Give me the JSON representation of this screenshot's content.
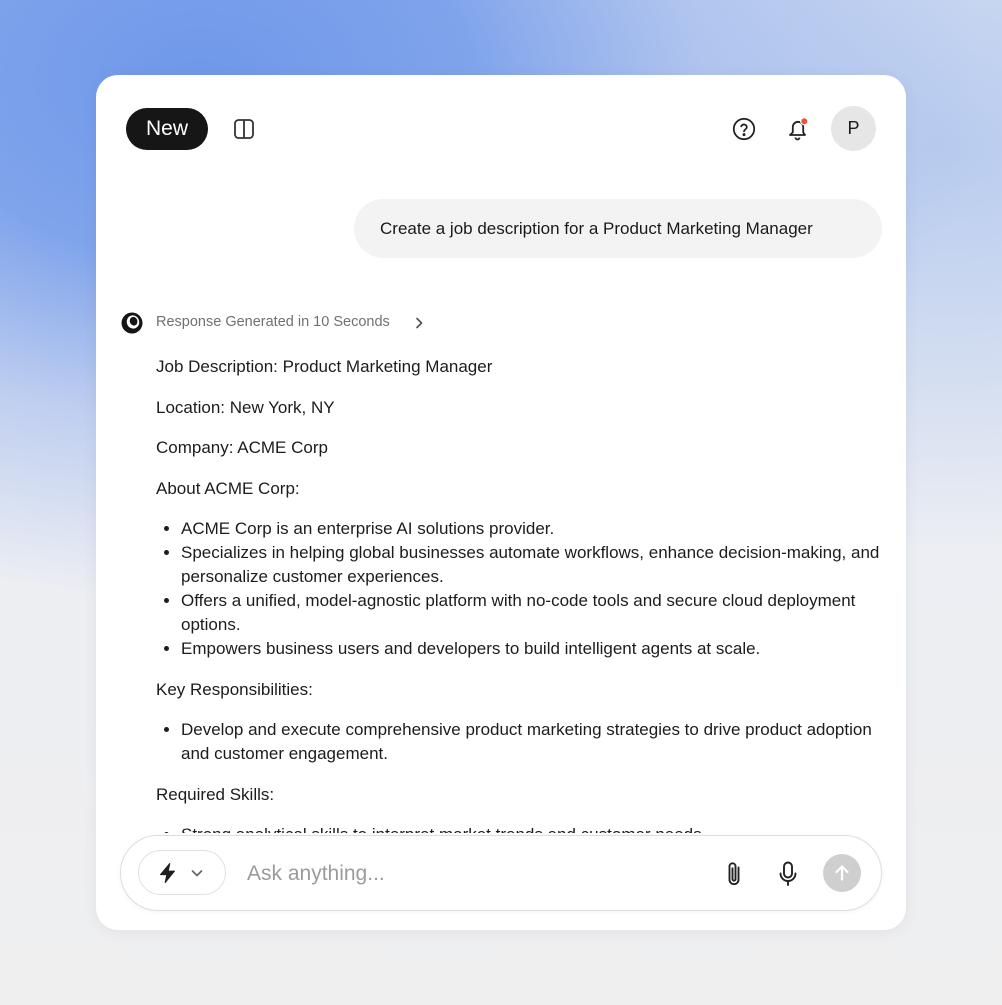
{
  "header": {
    "new_label": "New",
    "avatar_initial": "P",
    "notification_dot_color": "#f0533a"
  },
  "conversation": {
    "user_message": "Create a job description for a Product Marketing Manager",
    "response_status": "Response Generated in 10 Seconds",
    "response": {
      "title": "Job Description: Product Marketing Manager",
      "location": "Location: New York, NY",
      "company": "Company: ACME Corp",
      "about_heading": "About ACME Corp:",
      "about_items": [
        "ACME Corp is an enterprise AI solutions provider.",
        "Specializes in helping global businesses automate workflows, enhance decision-making, and personalize customer experiences.",
        "Offers a unified, model-agnostic platform with no-code tools and secure cloud deployment options.",
        "Empowers business users and developers to build intelligent agents at scale."
      ],
      "responsibilities_heading": "Key Responsibilities:",
      "responsibilities_items": [
        "Develop and execute comprehensive product marketing strategies to drive product adoption and customer engagement."
      ],
      "skills_heading": "Required Skills:",
      "skills_items": [
        "Strong analytical skills to interpret market trends and customer needs."
      ]
    }
  },
  "composer": {
    "placeholder": "Ask anything..."
  },
  "icons": {
    "sidebar_toggle": "sidebar-toggle-icon",
    "help": "help-icon",
    "bell": "bell-icon",
    "logo": "brand-logo-icon",
    "chevron_right": "chevron-right-icon",
    "bolt": "bolt-icon",
    "chevron_down": "chevron-down-icon",
    "attach": "paperclip-icon",
    "mic": "microphone-icon",
    "send": "arrow-up-icon"
  }
}
